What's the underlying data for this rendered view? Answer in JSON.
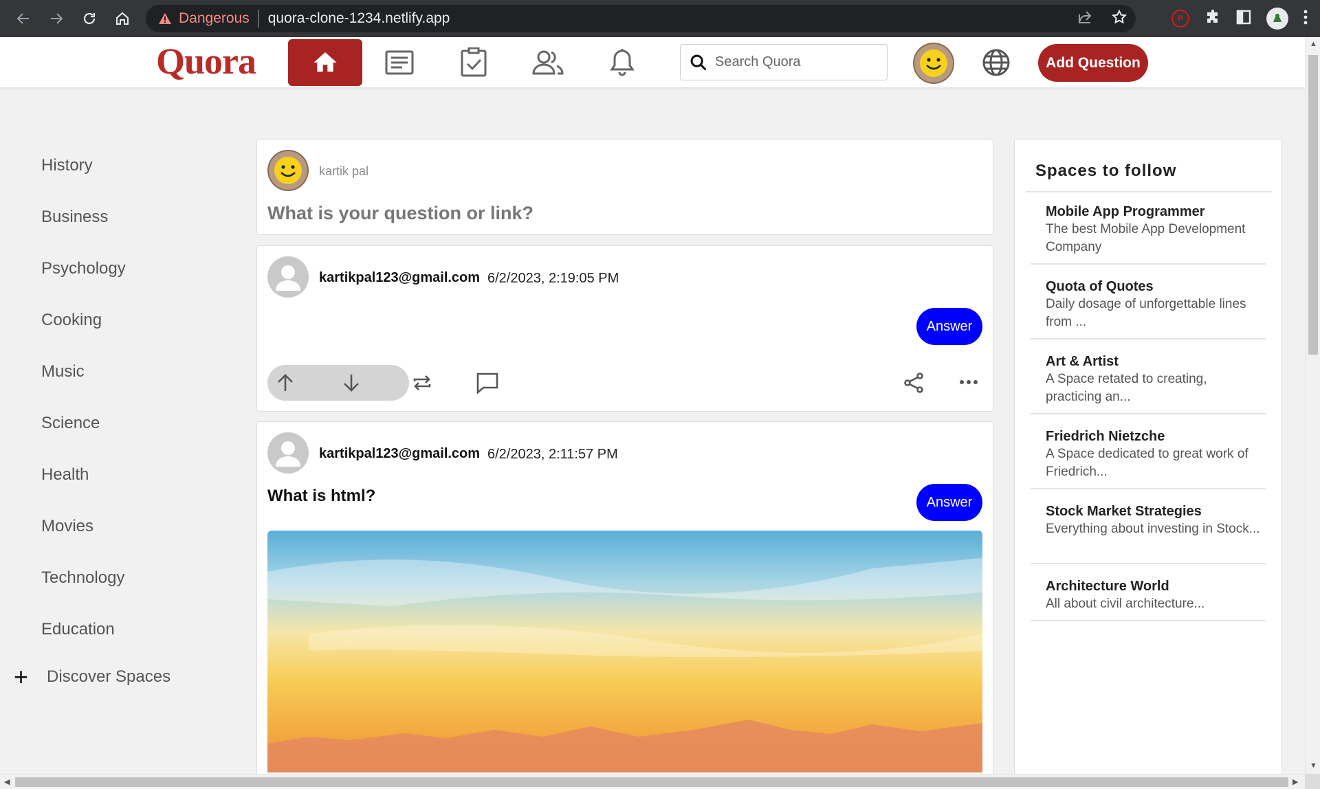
{
  "browser": {
    "security_label": "Dangerous",
    "url": "quora-clone-1234.netlify.app"
  },
  "header": {
    "logo": "Quora",
    "search_placeholder": "Search Quora",
    "add_question": "Add Question",
    "brand_color": "#a82423"
  },
  "sidebar": {
    "items": [
      "History",
      "Business",
      "Psychology",
      "Cooking",
      "Music",
      "Science",
      "Health",
      "Movies",
      "Technology",
      "Education"
    ],
    "discover": "Discover Spaces"
  },
  "composer": {
    "username": "kartik pal",
    "prompt": "What is your question or link?"
  },
  "posts": [
    {
      "author": "kartikpal123@gmail.com",
      "timestamp": "6/2/2023, 2:19:05 PM",
      "question": "",
      "answer_label": "Answer"
    },
    {
      "author": "kartikpal123@gmail.com",
      "timestamp": "6/2/2023, 2:11:57 PM",
      "question": "What is html?",
      "answer_label": "Answer"
    }
  ],
  "spaces": {
    "title": "Spaces to follow",
    "items": [
      {
        "name": "Mobile App Programmer",
        "desc": "The best Mobile App Development Company"
      },
      {
        "name": "Quota of Quotes",
        "desc": "Daily dosage of unforgettable lines from ..."
      },
      {
        "name": "Art & Artist",
        "desc": "A Space retated to creating, practicing an..."
      },
      {
        "name": "Friedrich Nietzche",
        "desc": "A Space dedicated to great work of Friedrich..."
      },
      {
        "name": "Stock Market Strategies",
        "desc": "Everything about investing in Stock..."
      },
      {
        "name": "Architecture World",
        "desc": "All about civil architecture..."
      }
    ]
  }
}
